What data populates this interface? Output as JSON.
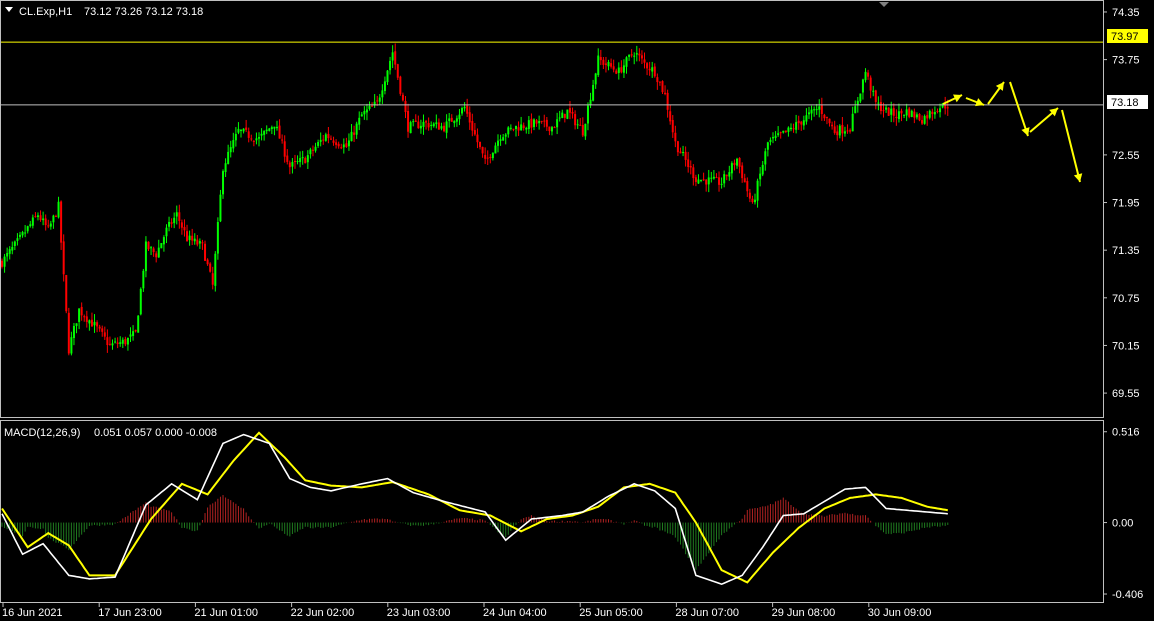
{
  "header": {
    "symbol_label": "CL.Exp,H1",
    "ohlc_label": "73.12 73.26 73.12 73.18"
  },
  "macd": {
    "label": "MACD(12,26,9)",
    "values_label": "0.051 0.057 0.000 -0.008"
  },
  "price_axis": {
    "ticks": [
      "74.35",
      "73.75",
      "72.55",
      "71.95",
      "71.35",
      "70.75",
      "70.15",
      "69.55"
    ],
    "tick_values": [
      74.35,
      73.75,
      72.55,
      71.95,
      71.35,
      70.75,
      70.15,
      69.55
    ],
    "range": [
      69.4,
      74.4
    ],
    "resistance_badge": "73.97",
    "resistance_value": 73.97,
    "current_badge": "73.18",
    "current_value": 73.18
  },
  "macd_axis": {
    "ticks": [
      "0.516",
      "0.00",
      "-0.406"
    ],
    "tick_values": [
      0.516,
      0.0,
      -0.406
    ],
    "range": [
      -0.44,
      0.56
    ]
  },
  "time_axis": {
    "labels": [
      "16 Jun 2021",
      "17 Jun 23:00",
      "21 Jun 01:00",
      "22 Jun 02:00",
      "23 Jun 03:00",
      "24 Jun 04:00",
      "25 Jun 05:00",
      "28 Jun 07:00",
      "29 Jun 08:00",
      "30 Jun 09:00"
    ]
  },
  "colors": {
    "background": "#000000",
    "bull_candle": "#00ff00",
    "bear_candle": "#ff0000",
    "macd_line": "#ffffff",
    "signal_line": "#ffff00",
    "hist_positive": "#b22222",
    "hist_negative": "#1f7a1f",
    "resistance_line": "#ffff00",
    "current_line": "#c0c0c0",
    "arrow": "#ffff00",
    "grid_border": "#c0c0c0"
  },
  "chart_data": {
    "type": "candlestick",
    "title": "CL.Exp,H1",
    "close_path_anchors": [
      [
        0,
        71.2
      ],
      [
        6,
        71.45
      ],
      [
        14,
        71.8
      ],
      [
        18,
        71.6
      ],
      [
        22,
        71.9
      ],
      [
        26,
        70.1
      ],
      [
        30,
        70.6
      ],
      [
        36,
        70.4
      ],
      [
        42,
        70.15
      ],
      [
        48,
        70.2
      ],
      [
        52,
        70.3
      ],
      [
        56,
        71.4
      ],
      [
        60,
        71.3
      ],
      [
        64,
        71.6
      ],
      [
        68,
        71.8
      ],
      [
        72,
        71.5
      ],
      [
        78,
        71.4
      ],
      [
        82,
        70.9
      ],
      [
        86,
        72.4
      ],
      [
        92,
        72.85
      ],
      [
        100,
        72.75
      ],
      [
        106,
        72.95
      ],
      [
        112,
        72.4
      ],
      [
        118,
        72.5
      ],
      [
        126,
        72.8
      ],
      [
        134,
        72.65
      ],
      [
        140,
        73.05
      ],
      [
        146,
        73.2
      ],
      [
        152,
        73.85
      ],
      [
        158,
        72.9
      ],
      [
        164,
        72.95
      ],
      [
        172,
        72.9
      ],
      [
        180,
        73.15
      ],
      [
        188,
        72.45
      ],
      [
        194,
        72.8
      ],
      [
        200,
        72.9
      ],
      [
        208,
        72.95
      ],
      [
        214,
        72.9
      ],
      [
        220,
        73.1
      ],
      [
        226,
        72.85
      ],
      [
        232,
        73.75
      ],
      [
        240,
        73.6
      ],
      [
        246,
        73.85
      ],
      [
        250,
        73.7
      ],
      [
        254,
        73.6
      ],
      [
        258,
        73.3
      ],
      [
        262,
        72.7
      ],
      [
        270,
        72.25
      ],
      [
        280,
        72.2
      ],
      [
        286,
        72.5
      ],
      [
        292,
        71.9
      ],
      [
        298,
        72.7
      ],
      [
        306,
        72.85
      ],
      [
        312,
        73.0
      ],
      [
        318,
        73.15
      ],
      [
        324,
        72.85
      ],
      [
        330,
        72.9
      ],
      [
        336,
        73.6
      ],
      [
        340,
        73.2
      ],
      [
        344,
        73.1
      ],
      [
        348,
        73.05
      ],
      [
        352,
        73.1
      ],
      [
        358,
        73.0
      ],
      [
        364,
        73.15
      ],
      [
        368,
        73.18
      ]
    ],
    "macd_anchors": [
      [
        0,
        0.05
      ],
      [
        8,
        -0.18
      ],
      [
        16,
        -0.12
      ],
      [
        26,
        -0.3
      ],
      [
        34,
        -0.32
      ],
      [
        44,
        -0.31
      ],
      [
        56,
        0.1
      ],
      [
        66,
        0.22
      ],
      [
        76,
        0.13
      ],
      [
        86,
        0.45
      ],
      [
        94,
        0.5
      ],
      [
        104,
        0.45
      ],
      [
        112,
        0.25
      ],
      [
        120,
        0.2
      ],
      [
        128,
        0.18
      ],
      [
        140,
        0.22
      ],
      [
        150,
        0.25
      ],
      [
        160,
        0.17
      ],
      [
        172,
        0.12
      ],
      [
        188,
        0.06
      ],
      [
        196,
        -0.1
      ],
      [
        206,
        0.02
      ],
      [
        218,
        0.04
      ],
      [
        226,
        0.06
      ],
      [
        236,
        0.15
      ],
      [
        246,
        0.22
      ],
      [
        254,
        0.18
      ],
      [
        262,
        0.08
      ],
      [
        270,
        -0.3
      ],
      [
        280,
        -0.35
      ],
      [
        288,
        -0.3
      ],
      [
        296,
        -0.14
      ],
      [
        304,
        0.04
      ],
      [
        312,
        0.05
      ],
      [
        320,
        0.12
      ],
      [
        328,
        0.19
      ],
      [
        336,
        0.2
      ],
      [
        344,
        0.08
      ],
      [
        352,
        0.07
      ],
      [
        360,
        0.06
      ],
      [
        368,
        0.05
      ]
    ],
    "signal_anchors": [
      [
        0,
        0.08
      ],
      [
        10,
        -0.14
      ],
      [
        18,
        -0.06
      ],
      [
        26,
        -0.13
      ],
      [
        34,
        -0.3
      ],
      [
        44,
        -0.3
      ],
      [
        58,
        0.02
      ],
      [
        70,
        0.22
      ],
      [
        80,
        0.16
      ],
      [
        90,
        0.35
      ],
      [
        100,
        0.51
      ],
      [
        110,
        0.37
      ],
      [
        118,
        0.24
      ],
      [
        128,
        0.21
      ],
      [
        140,
        0.2
      ],
      [
        152,
        0.23
      ],
      [
        166,
        0.16
      ],
      [
        178,
        0.07
      ],
      [
        190,
        0.04
      ],
      [
        202,
        -0.05
      ],
      [
        212,
        0.02
      ],
      [
        222,
        0.04
      ],
      [
        232,
        0.09
      ],
      [
        242,
        0.2
      ],
      [
        252,
        0.22
      ],
      [
        262,
        0.17
      ],
      [
        270,
        0.0
      ],
      [
        280,
        -0.27
      ],
      [
        290,
        -0.34
      ],
      [
        300,
        -0.17
      ],
      [
        310,
        -0.03
      ],
      [
        320,
        0.08
      ],
      [
        330,
        0.14
      ],
      [
        340,
        0.16
      ],
      [
        350,
        0.14
      ],
      [
        360,
        0.09
      ],
      [
        368,
        0.07
      ]
    ],
    "projection_arrows": [
      [
        [
          943,
          104
        ],
        [
          962,
          95
        ]
      ],
      [
        [
          966,
          98
        ],
        [
          984,
          105
        ]
      ],
      [
        [
          988,
          104
        ],
        [
          1004,
          82
        ]
      ],
      [
        [
          1010,
          82
        ],
        [
          1028,
          136
        ]
      ],
      [
        [
          1030,
          132
        ],
        [
          1058,
          108
        ]
      ],
      [
        [
          1062,
          110
        ],
        [
          1080,
          182
        ]
      ]
    ],
    "ylim": [
      69.4,
      74.4
    ],
    "macd_ylim": [
      -0.44,
      0.56
    ]
  }
}
